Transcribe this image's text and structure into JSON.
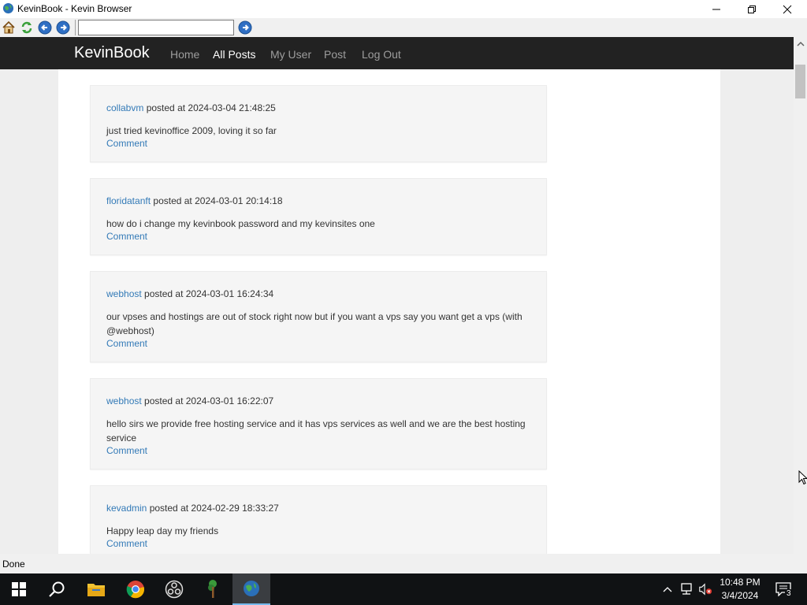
{
  "window": {
    "title": "KevinBook - Kevin Browser"
  },
  "toolbar": {
    "buttons": [
      "home-icon",
      "refresh-icon",
      "back-icon",
      "forward-icon"
    ],
    "address_value": "",
    "go_icon": "go-icon"
  },
  "site": {
    "brand": "KevinBook",
    "nav": [
      "Home",
      "All Posts",
      "My User",
      "Post",
      "Log Out"
    ],
    "active_nav": "All Posts"
  },
  "posts": [
    {
      "user": "collabvm",
      "posted_at": "posted at 2024-03-04 21:48:25",
      "text": "just tried kevinoffice 2009, loving it so far",
      "comment": "Comment"
    },
    {
      "user": "floridatanft",
      "posted_at": "posted at 2024-03-01 20:14:18",
      "text": "how do i change my kevinbook password and my kevinsites one",
      "comment": "Comment"
    },
    {
      "user": "webhost",
      "posted_at": "posted at 2024-03-01 16:24:34",
      "text": "our vpses and hostings are out of stock right now but if you want a vps say you want get a vps (with @webhost)",
      "comment": "Comment"
    },
    {
      "user": "webhost",
      "posted_at": "posted at 2024-03-01 16:22:07",
      "text": "hello sirs we provide free hosting service and it has vps services as well and we are the best hosting service",
      "comment": "Comment"
    },
    {
      "user": "kevadmin",
      "posted_at": "posted at 2024-02-29 18:33:27",
      "text": "Happy leap day my friends",
      "comment": "Comment"
    }
  ],
  "statusbar": {
    "text": "Done"
  },
  "taskbar": {
    "apps": [
      "start-icon",
      "search-icon",
      "file-explorer-icon",
      "chrome-icon",
      "obs-icon",
      "tree-app-icon",
      "kevin-browser-icon"
    ],
    "tray": [
      "show-hidden-icons-chevron",
      "network-icon",
      "volume-muted-icon"
    ],
    "time": "10:48 PM",
    "date": "3/4/2024",
    "notifications_count": "3"
  },
  "colors": {
    "link": "#337ab7",
    "navbar": "#222222",
    "post_bg": "#f5f5f5",
    "page_bg": "#eeeeee",
    "taskbar": "#101214"
  }
}
